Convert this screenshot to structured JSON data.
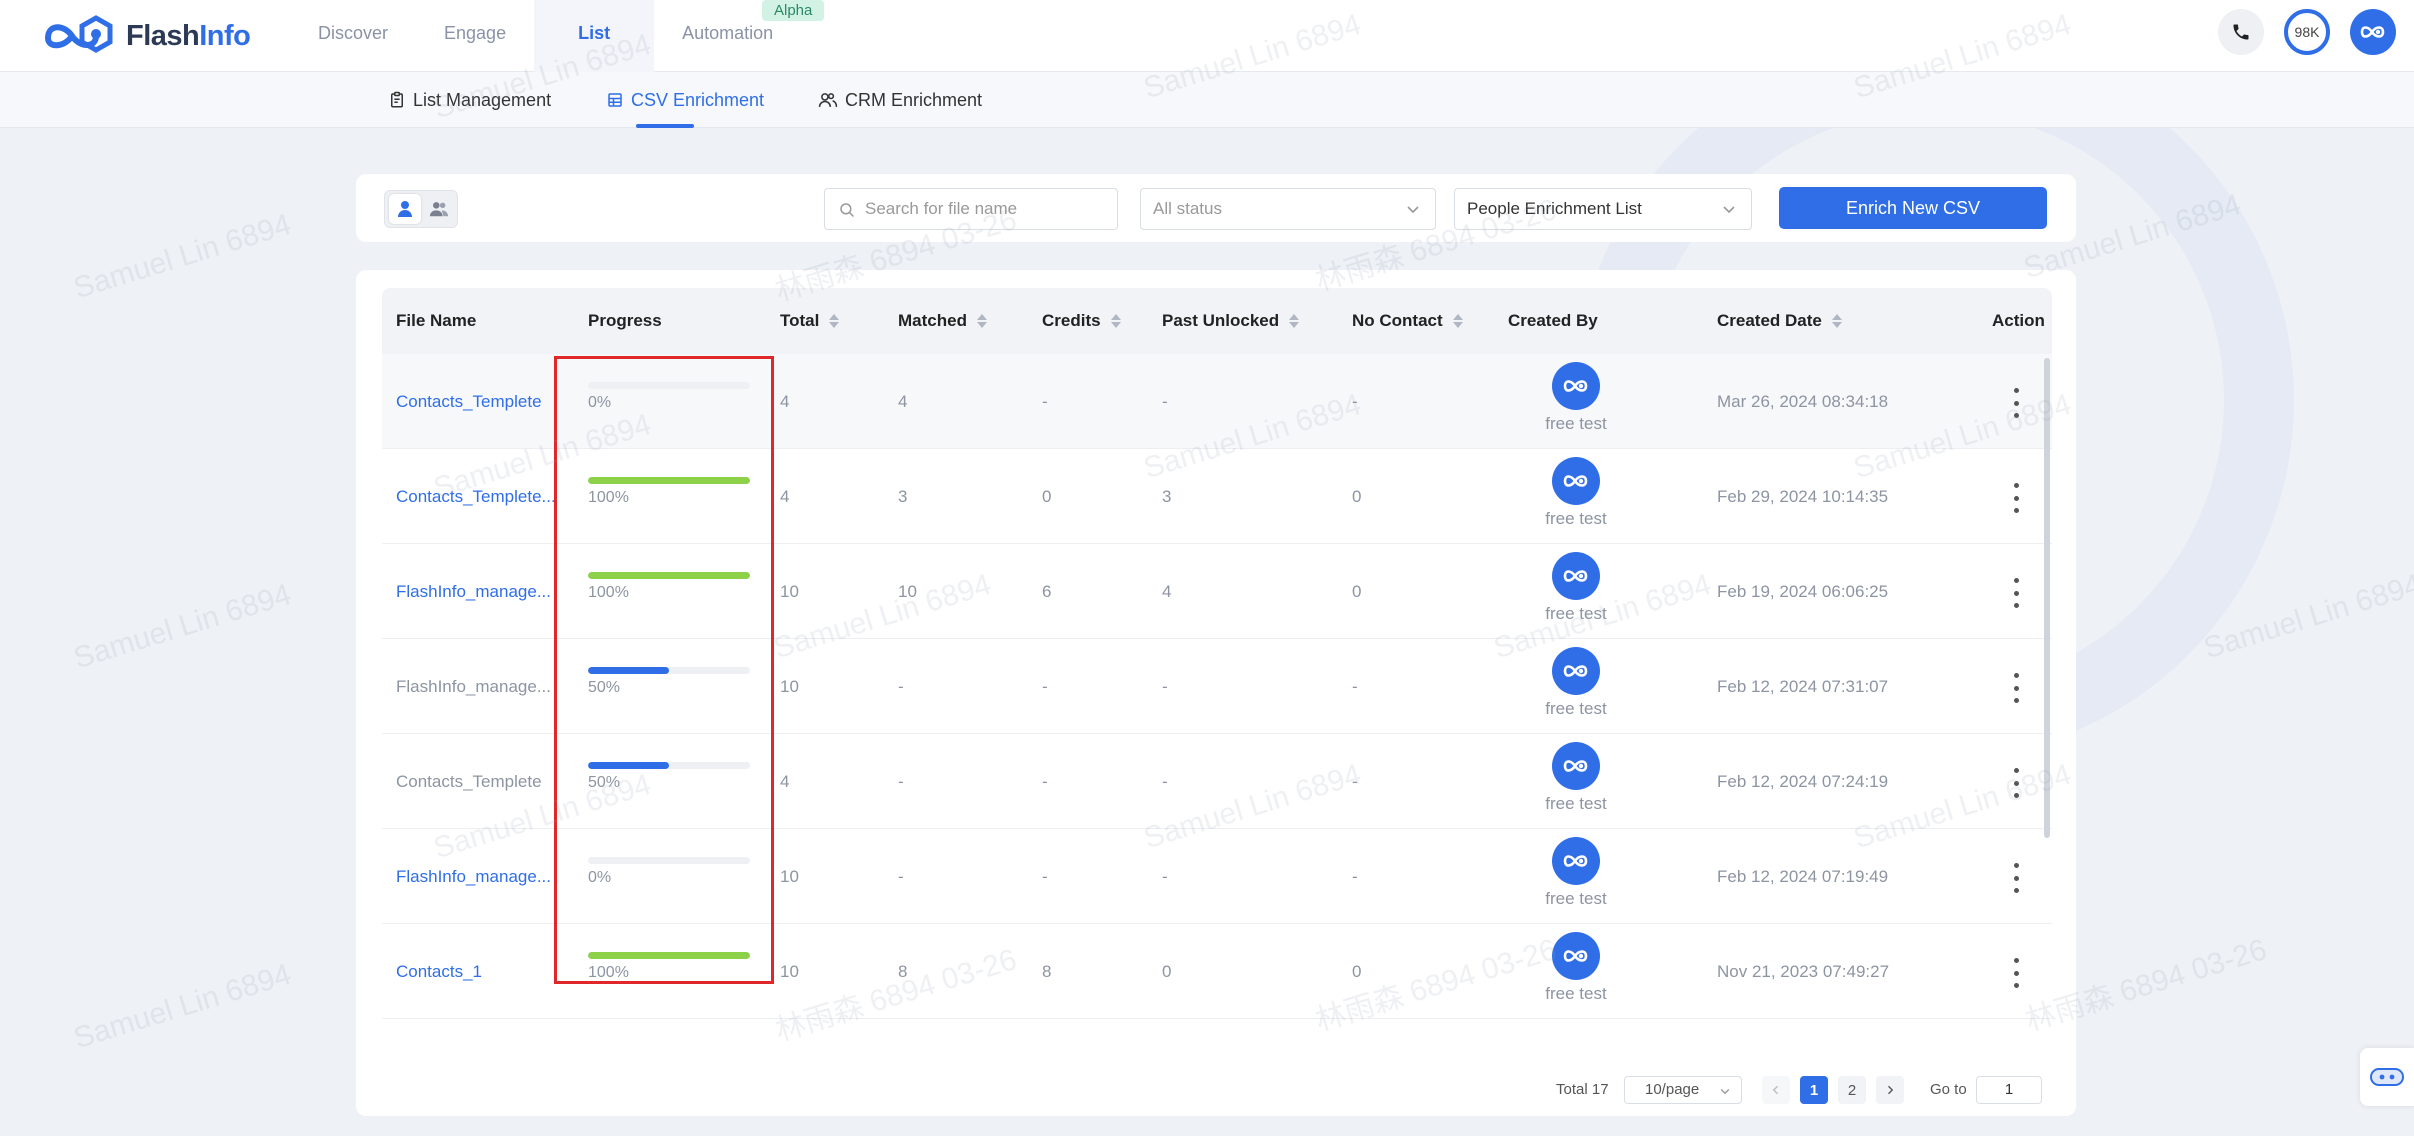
{
  "app": {
    "logo_brand_a": "Flash",
    "logo_brand_b": "Info",
    "brand_color": "#2f6ee6"
  },
  "nav": {
    "items": [
      {
        "label": "Discover"
      },
      {
        "label": "Engage"
      },
      {
        "label": "List"
      },
      {
        "label": "Automation"
      }
    ],
    "active": "List",
    "automation_badge": "Alpha"
  },
  "top_right": {
    "credits": "98K"
  },
  "subnav": {
    "items": [
      {
        "label": "List Management",
        "icon": "clipboard-icon"
      },
      {
        "label": "CSV Enrichment",
        "icon": "table-icon"
      },
      {
        "label": "CRM Enrichment",
        "icon": "users-icon"
      }
    ],
    "active": "CSV Enrichment"
  },
  "filters": {
    "search_placeholder": "Search for file name",
    "status_select": "All status",
    "list_select": "People Enrichment List",
    "enrich_button": "Enrich New CSV"
  },
  "table": {
    "columns": [
      "File Name",
      "Progress",
      "Total",
      "Matched",
      "Credits",
      "Past Unlocked",
      "No Contact",
      "Created By",
      "Created Date",
      "Action"
    ],
    "rows": [
      {
        "file": "Contacts_Templete",
        "link": true,
        "progress": 0,
        "progress_label": "0%",
        "total": "4",
        "matched": "4",
        "credits": "-",
        "past_unlocked": "-",
        "no_contact": "-",
        "created_by": "free test",
        "created_date": "Mar 26, 2024 08:34:18"
      },
      {
        "file": "Contacts_Templete...",
        "link": true,
        "progress": 100,
        "progress_label": "100%",
        "total": "4",
        "matched": "3",
        "credits": "0",
        "past_unlocked": "3",
        "no_contact": "0",
        "created_by": "free test",
        "created_date": "Feb 29, 2024 10:14:35"
      },
      {
        "file": "FlashInfo_manage...",
        "link": true,
        "progress": 100,
        "progress_label": "100%",
        "total": "10",
        "matched": "10",
        "credits": "6",
        "past_unlocked": "4",
        "no_contact": "0",
        "created_by": "free test",
        "created_date": "Feb 19, 2024 06:06:25"
      },
      {
        "file": "FlashInfo_manage...",
        "link": false,
        "progress": 50,
        "progress_label": "50%",
        "total": "10",
        "matched": "-",
        "credits": "-",
        "past_unlocked": "-",
        "no_contact": "-",
        "created_by": "free test",
        "created_date": "Feb 12, 2024 07:31:07"
      },
      {
        "file": "Contacts_Templete",
        "link": false,
        "progress": 50,
        "progress_label": "50%",
        "total": "4",
        "matched": "-",
        "credits": "-",
        "past_unlocked": "-",
        "no_contact": "-",
        "created_by": "free test",
        "created_date": "Feb 12, 2024 07:24:19"
      },
      {
        "file": "FlashInfo_manage...",
        "link": true,
        "progress": 0,
        "progress_label": "0%",
        "total": "10",
        "matched": "-",
        "credits": "-",
        "past_unlocked": "-",
        "no_contact": "-",
        "created_by": "free test",
        "created_date": "Feb 12, 2024 07:19:49"
      },
      {
        "file": "Contacts_1",
        "link": true,
        "progress": 100,
        "progress_label": "100%",
        "total": "10",
        "matched": "8",
        "credits": "8",
        "past_unlocked": "0",
        "no_contact": "0",
        "created_by": "free test",
        "created_date": "Nov 21, 2023 07:49:27"
      }
    ],
    "progress_colors": {
      "complete": "#8cd148",
      "partial": "#2f6ee6",
      "track": "#eef0f3"
    }
  },
  "pagination": {
    "total": "Total 17",
    "page_size": "10/page",
    "pages": [
      "1",
      "2"
    ],
    "current": "1",
    "goto_label": "Go to",
    "goto_value": "1"
  },
  "watermark": {
    "text": "Samuel Lin 6894",
    "text_cn": "林雨森 6894 03-26"
  },
  "highlight_color": "#e0282b"
}
